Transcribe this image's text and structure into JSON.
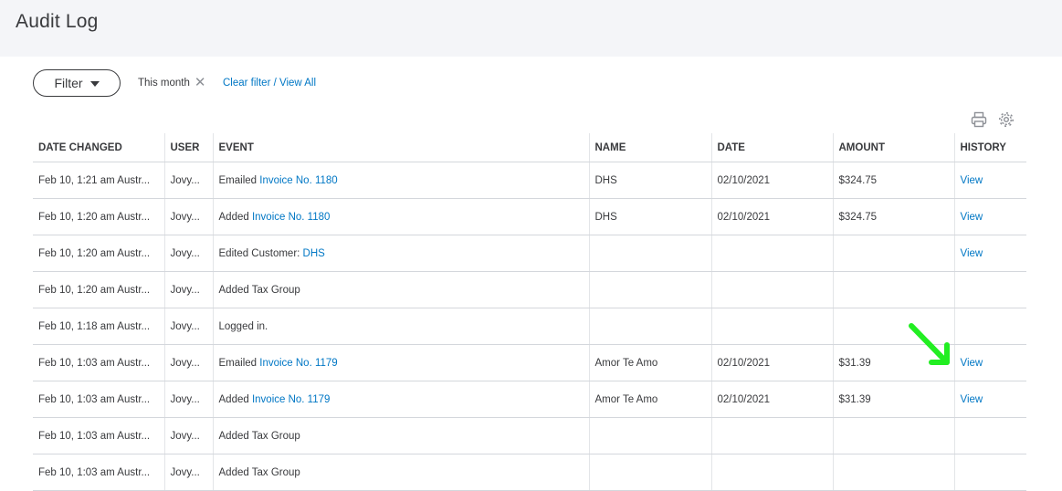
{
  "page": {
    "title": "Audit Log"
  },
  "filter": {
    "button_label": "Filter",
    "chip_label": "This month",
    "clear_link": "Clear filter / View All"
  },
  "toolbar": {
    "icons": [
      "print-icon",
      "settings-gear-icon"
    ]
  },
  "table": {
    "headers": [
      "DATE CHANGED",
      "USER",
      "EVENT",
      "NAME",
      "DATE",
      "AMOUNT",
      "HISTORY"
    ],
    "rows": [
      {
        "date_changed": "Feb 10, 1:21 am Austr...",
        "user": "Jovy...",
        "event_text": "Emailed ",
        "event_link": "Invoice No. 1180",
        "name": "DHS",
        "date": "02/10/2021",
        "amount": "$324.75",
        "history": "View"
      },
      {
        "date_changed": "Feb 10, 1:20 am Austr...",
        "user": "Jovy...",
        "event_text": "Added ",
        "event_link": "Invoice No. 1180",
        "name": "DHS",
        "date": "02/10/2021",
        "amount": "$324.75",
        "history": "View"
      },
      {
        "date_changed": "Feb 10, 1:20 am Austr...",
        "user": "Jovy...",
        "event_text": "Edited Customer: ",
        "event_link": "DHS",
        "name": "",
        "date": "",
        "amount": "",
        "history": "View"
      },
      {
        "date_changed": "Feb 10, 1:20 am Austr...",
        "user": "Jovy...",
        "event_text": "Added Tax Group",
        "event_link": "",
        "name": "",
        "date": "",
        "amount": "",
        "history": ""
      },
      {
        "date_changed": "Feb 10, 1:18 am Austr...",
        "user": "Jovy...",
        "event_text": "Logged in.",
        "event_link": "",
        "name": "",
        "date": "",
        "amount": "",
        "history": ""
      },
      {
        "date_changed": "Feb 10, 1:03 am Austr...",
        "user": "Jovy...",
        "event_text": "Emailed ",
        "event_link": "Invoice No. 1179",
        "name": "Amor Te Amo",
        "date": "02/10/2021",
        "amount": "$31.39",
        "history": "View"
      },
      {
        "date_changed": "Feb 10, 1:03 am Austr...",
        "user": "Jovy...",
        "event_text": "Added ",
        "event_link": "Invoice No. 1179",
        "name": "Amor Te Amo",
        "date": "02/10/2021",
        "amount": "$31.39",
        "history": "View"
      },
      {
        "date_changed": "Feb 10, 1:03 am Austr...",
        "user": "Jovy...",
        "event_text": "Added Tax Group",
        "event_link": "",
        "name": "",
        "date": "",
        "amount": "",
        "history": ""
      },
      {
        "date_changed": "Feb 10, 1:03 am Austr...",
        "user": "Jovy...",
        "event_text": "Added Tax Group",
        "event_link": "",
        "name": "",
        "date": "",
        "amount": "",
        "history": ""
      }
    ]
  },
  "annotation": {
    "arrow_color": "#22ee22",
    "icon": "green-arrow-icon"
  },
  "colors": {
    "link": "#0077c5",
    "header_bg": "#f4f5f8",
    "text": "#393a3d"
  }
}
